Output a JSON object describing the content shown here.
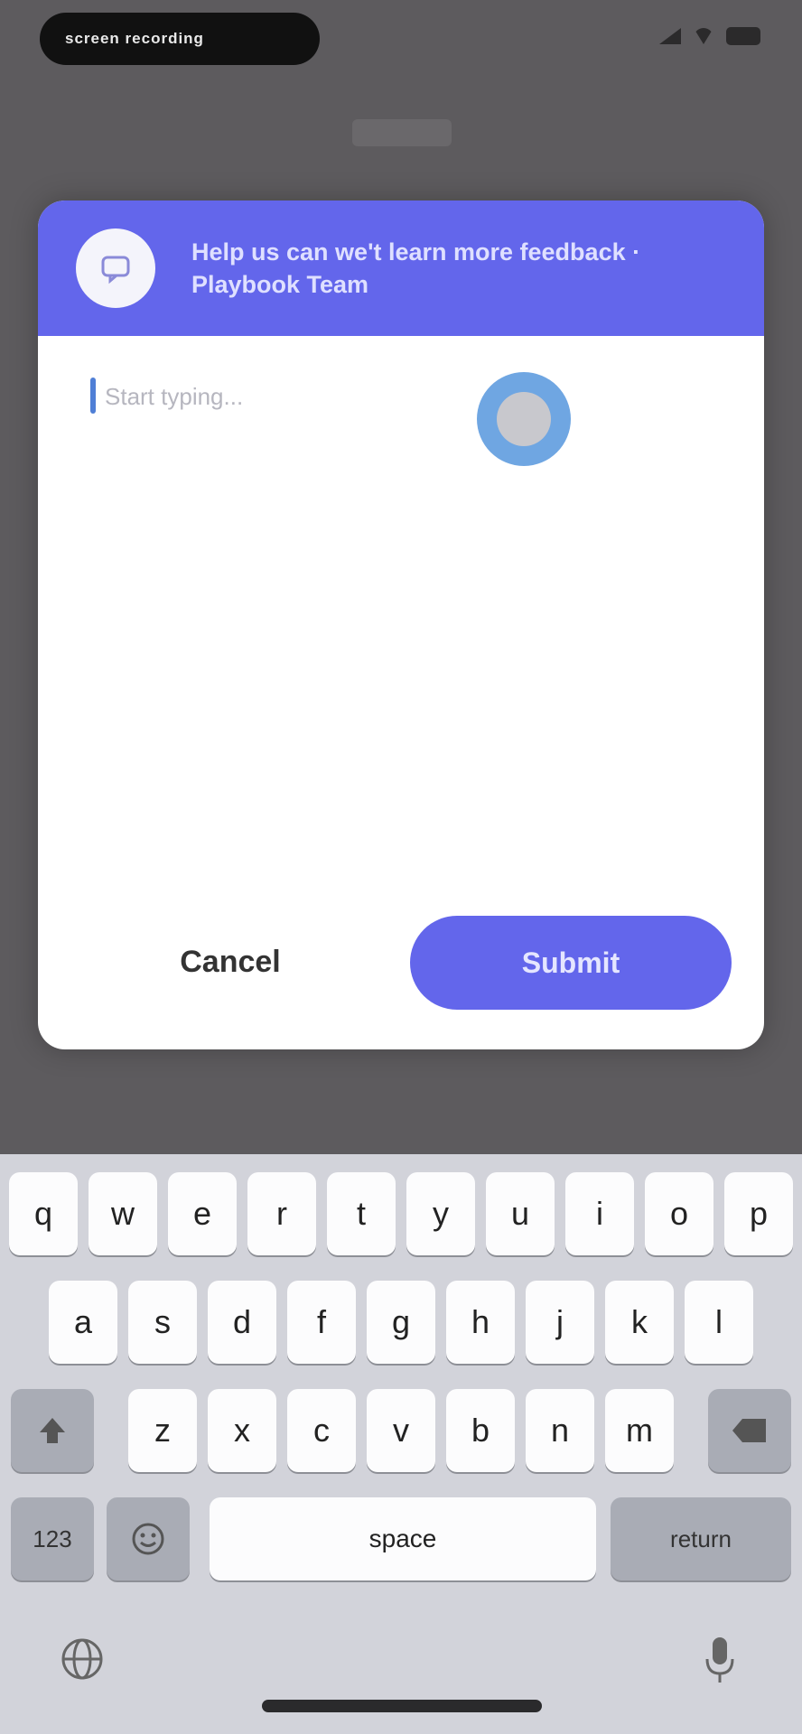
{
  "status_bar": {
    "pill_text": "screen recording"
  },
  "dialog": {
    "title": "Help us can we't learn more feedback · Playbook Team",
    "placeholder": "Start typing...",
    "cancel_label": "Cancel",
    "submit_label": "Submit"
  },
  "keyboard": {
    "row1": [
      "q",
      "w",
      "e",
      "r",
      "t",
      "y",
      "u",
      "i",
      "o",
      "p"
    ],
    "row2": [
      "a",
      "s",
      "d",
      "f",
      "g",
      "h",
      "j",
      "k",
      "l"
    ],
    "row3": [
      "z",
      "x",
      "c",
      "v",
      "b",
      "n",
      "m"
    ],
    "numbers_label": "123",
    "space_label": "space",
    "return_label": "return"
  },
  "colors": {
    "accent": "#6366eb",
    "overlay": "#5d5b5e",
    "keyboard_bg": "#d2d3da"
  },
  "icons": [
    "shift-icon",
    "delete-icon",
    "emoji-icon",
    "globe-icon",
    "microphone-icon",
    "chat-icon"
  ]
}
